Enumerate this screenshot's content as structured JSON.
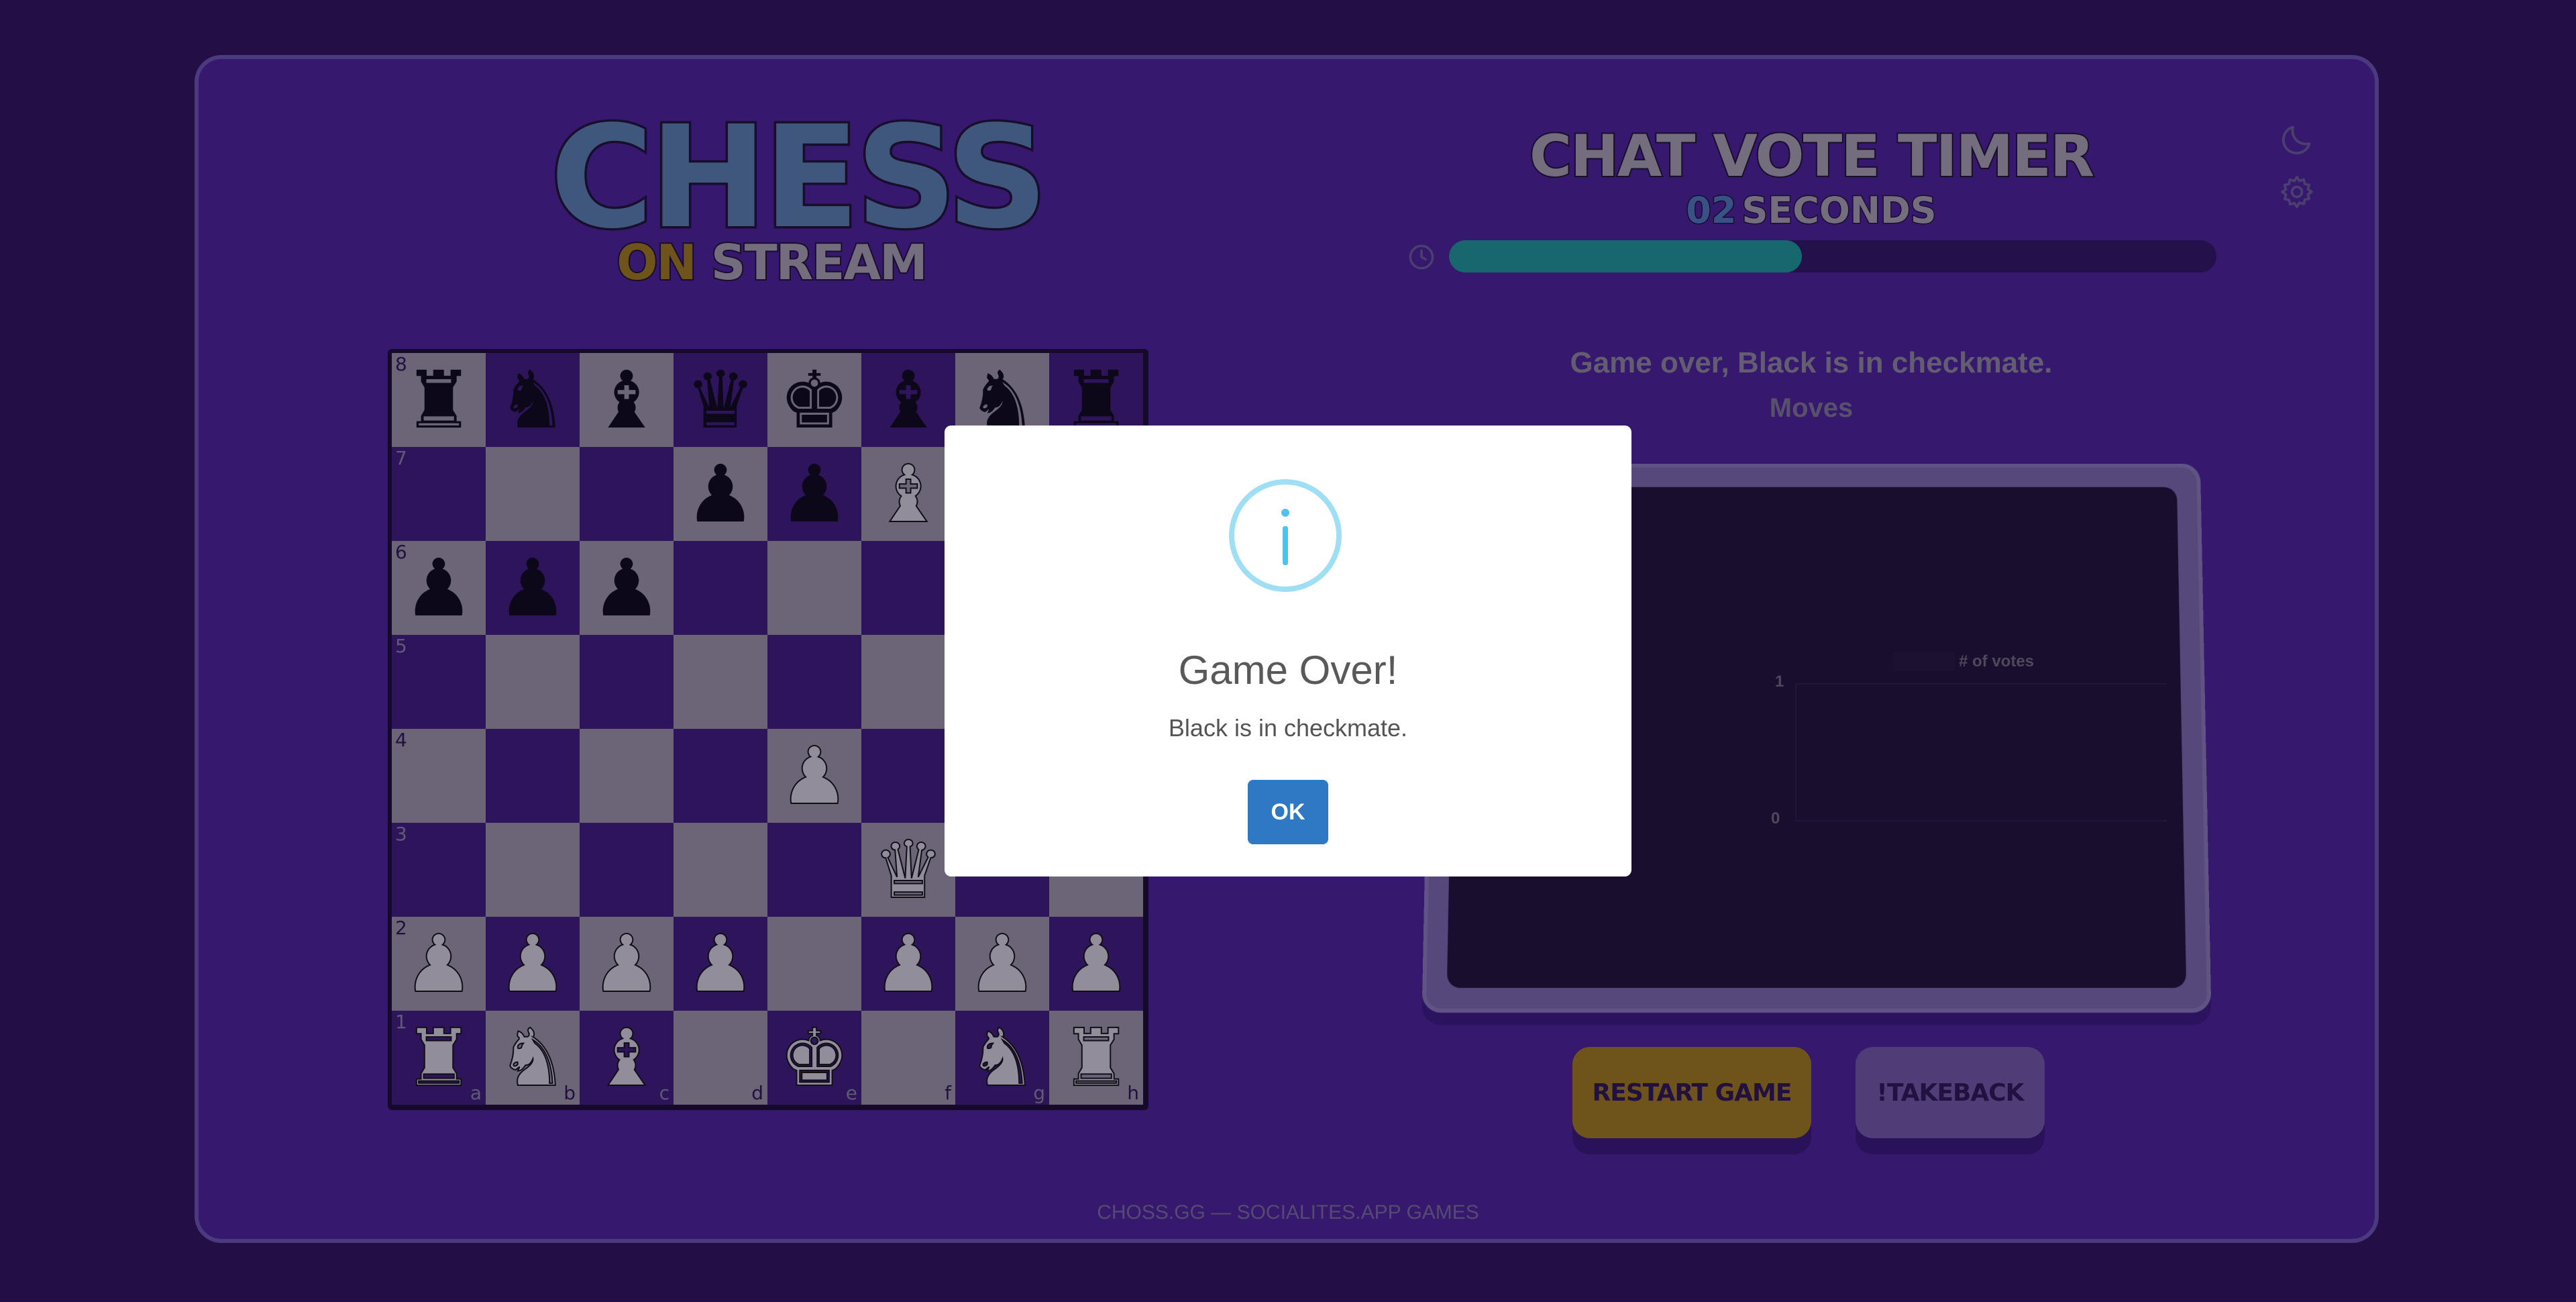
{
  "logo": {
    "main": "CHESS",
    "on": "ON",
    "stream": "STREAM"
  },
  "header": {
    "vote_title": "CHAT VOTE TIMER",
    "seconds_value": "02",
    "seconds_label": "SECONDS",
    "timer_progress": 0.46
  },
  "board": {
    "files": [
      "a",
      "b",
      "c",
      "d",
      "e",
      "f",
      "g",
      "h"
    ],
    "ranks": [
      "8",
      "7",
      "6",
      "5",
      "4",
      "3",
      "2",
      "1"
    ],
    "position": [
      [
        "r",
        "n",
        "b",
        "q",
        "k",
        "b",
        "n",
        "r"
      ],
      [
        "",
        "",
        "",
        "p",
        "p",
        "B",
        "",
        ""
      ],
      [
        "p",
        "p",
        "p",
        "",
        "",
        "",
        "",
        ""
      ],
      [
        "",
        "",
        "",
        "",
        "",
        "",
        "",
        ""
      ],
      [
        "",
        "",
        "",
        "",
        "P",
        "",
        "",
        ""
      ],
      [
        "",
        "",
        "",
        "",
        "",
        "Q",
        "",
        ""
      ],
      [
        "P",
        "P",
        "P",
        "P",
        "",
        "P",
        "P",
        "P"
      ],
      [
        "R",
        "N",
        "B",
        "",
        "K",
        "",
        "N",
        "R"
      ]
    ]
  },
  "game": {
    "status": "Game over, Black is in checkmate.",
    "moves_label": "Moves"
  },
  "chart_data": {
    "type": "bar",
    "categories": [],
    "series": [
      {
        "name": "# of votes",
        "values": []
      }
    ],
    "ylim": [
      0,
      1
    ],
    "yticks": [
      "1",
      "0"
    ]
  },
  "buttons": {
    "restart": "RESTART GAME",
    "takeback": "!TAKEBACK"
  },
  "footer": {
    "text": "CHOSS.GG — SOCIALITES.APP GAMES"
  },
  "modal": {
    "icon": "i",
    "title": "Game Over!",
    "text": "Black is in checkmate.",
    "ok": "OK"
  },
  "icons": {
    "theme": "moon-icon",
    "settings": "gear-icon",
    "clock": "clock-icon",
    "info": "info-icon"
  },
  "colors": {
    "accent": "#a07d14",
    "timer": "#1a9c95",
    "panel": "#4a2196",
    "ok_button": "#2f78c4"
  }
}
